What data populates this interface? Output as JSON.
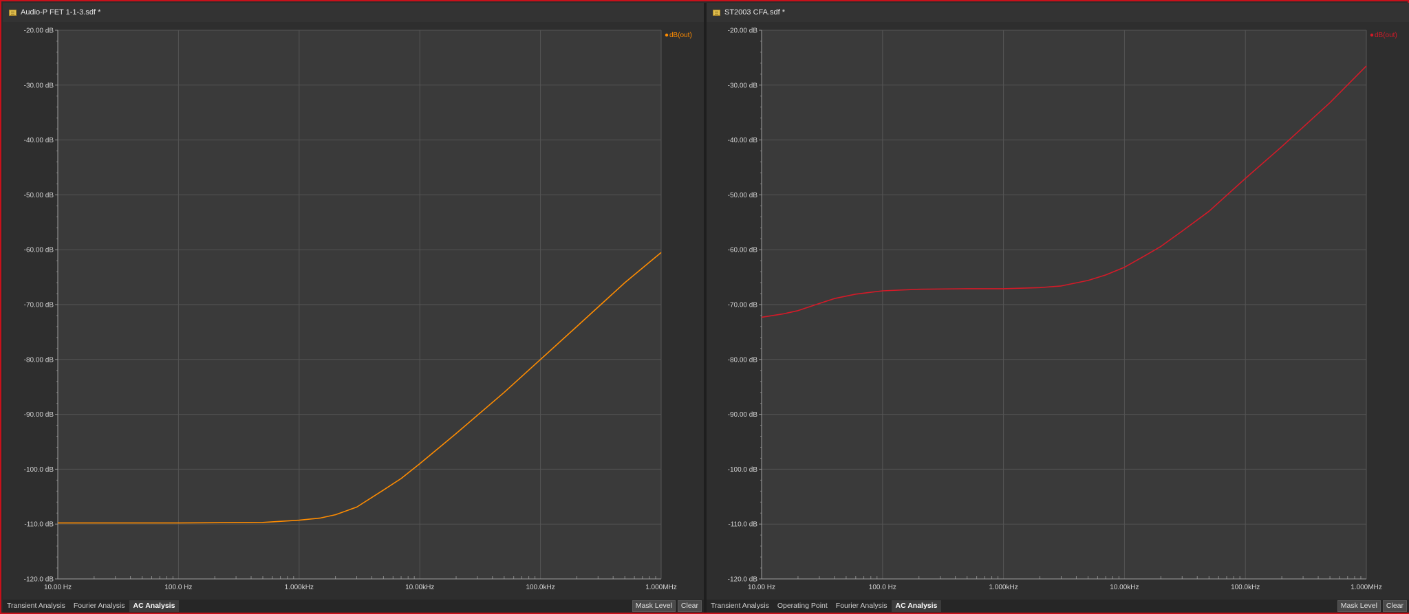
{
  "panels": [
    {
      "title": "Audio-P FET 1-1-3.sdf *",
      "tabs": [
        "Transient Analysis",
        "Fourier Analysis",
        "AC Analysis"
      ],
      "active_tab": 2,
      "buttons": {
        "mask_level": "Mask Level",
        "clear": "Clear"
      }
    },
    {
      "title": "ST2003 CFA.sdf *",
      "tabs": [
        "Transient Analysis",
        "Operating Point",
        "Fourier Analysis",
        "AC Analysis"
      ],
      "active_tab": 3,
      "buttons": {
        "mask_level": "Mask Level",
        "clear": "Clear"
      }
    }
  ],
  "chart_data": [
    {
      "type": "line",
      "xscale": "log",
      "xlim": [
        10,
        1000000
      ],
      "ylim": [
        -120,
        -20
      ],
      "grid": true,
      "legend_position": "top-right",
      "x_tick_values": [
        10,
        100,
        1000,
        10000,
        100000,
        1000000
      ],
      "x_tick_labels": [
        "10.00 Hz",
        "100.0 Hz",
        "1.000kHz",
        "10.00kHz",
        "100.0kHz",
        "1.000MHz"
      ],
      "y_tick_values": [
        -20,
        -30,
        -40,
        -50,
        -60,
        -70,
        -80,
        -90,
        -100,
        -110,
        -120
      ],
      "y_tick_labels": [
        "-20.00 dB",
        "-30.00 dB",
        "-40.00 dB",
        "-50.00 dB",
        "-60.00 dB",
        "-70.00 dB",
        "-80.00 dB",
        "-90.00 dB",
        "-100.0 dB",
        "-110.0 dB",
        "-120.0 dB"
      ],
      "series": [
        {
          "name": "dB(out)",
          "color": "#ff8c00",
          "x": [
            10,
            100,
            500,
            1000,
            1500,
            2000,
            3000,
            5000,
            7000,
            10000,
            20000,
            50000,
            100000,
            200000,
            500000,
            1000000
          ],
          "y": [
            -109.8,
            -109.8,
            -109.7,
            -109.3,
            -108.9,
            -108.3,
            -106.9,
            -103.8,
            -101.7,
            -99.0,
            -93.5,
            -86.0,
            -80.0,
            -74.0,
            -66.0,
            -60.5
          ]
        }
      ]
    },
    {
      "type": "line",
      "xscale": "log",
      "xlim": [
        10,
        1000000
      ],
      "ylim": [
        -120,
        -20
      ],
      "grid": true,
      "legend_position": "top-right",
      "x_tick_values": [
        10,
        100,
        1000,
        10000,
        100000,
        1000000
      ],
      "x_tick_labels": [
        "10.00 Hz",
        "100.0 Hz",
        "1.000kHz",
        "10.00kHz",
        "100.0kHz",
        "1.000MHz"
      ],
      "y_tick_values": [
        -20,
        -30,
        -40,
        -50,
        -60,
        -70,
        -80,
        -90,
        -100,
        -110,
        -120
      ],
      "y_tick_labels": [
        "-20.00 dB",
        "-30.00 dB",
        "-40.00 dB",
        "-50.00 dB",
        "-60.00 dB",
        "-70.00 dB",
        "-80.00 dB",
        "-90.00 dB",
        "-100.0 dB",
        "-110.0 dB",
        "-120.0 dB"
      ],
      "series": [
        {
          "name": "dB(out)",
          "color": "#d41a28",
          "x": [
            10,
            15,
            20,
            30,
            40,
            60,
            100,
            200,
            500,
            1000,
            2000,
            3000,
            5000,
            7000,
            10000,
            15000,
            20000,
            30000,
            50000,
            100000,
            200000,
            500000,
            1000000
          ],
          "y": [
            -72.3,
            -71.7,
            -71.1,
            -69.8,
            -68.9,
            -68.1,
            -67.5,
            -67.2,
            -67.1,
            -67.1,
            -66.9,
            -66.6,
            -65.6,
            -64.6,
            -63.2,
            -61.0,
            -59.4,
            -56.6,
            -53.0,
            -47.0,
            -41.2,
            -33.2,
            -26.5
          ]
        }
      ]
    }
  ]
}
